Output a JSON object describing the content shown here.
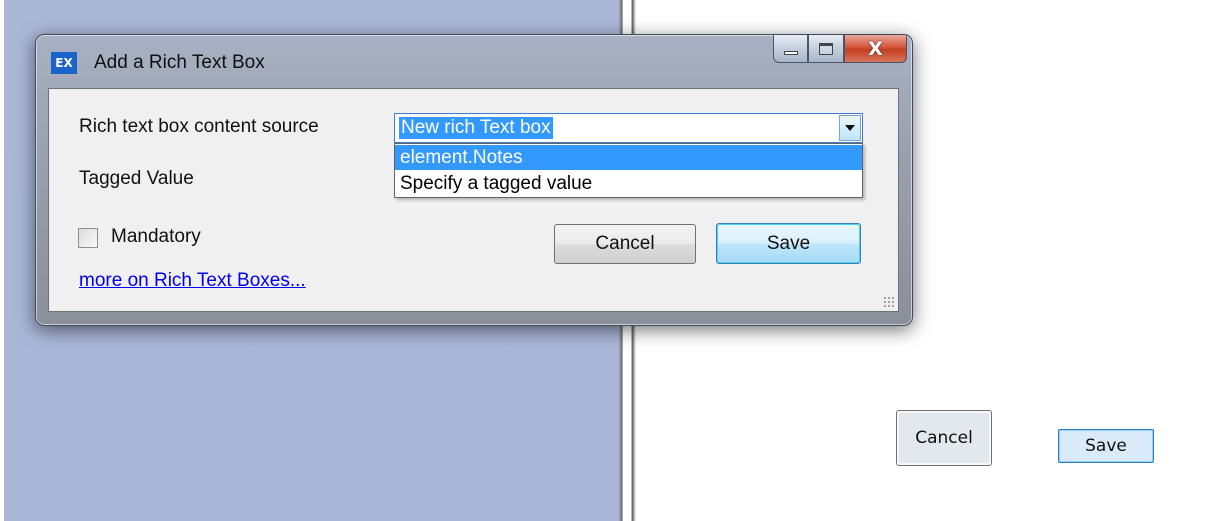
{
  "window": {
    "title": "Add a Rich Text Box",
    "app_icon_text": "EX",
    "close_glyph": "X"
  },
  "form": {
    "source_label": "Rich text box content source",
    "source_value": "New rich Text box",
    "source_options": [
      "element.Notes",
      "Specify a tagged value"
    ],
    "tagged_value_label": "Tagged Value",
    "mandatory_label": "Mandatory",
    "mandatory_checked": false,
    "help_link": "more on Rich Text Boxes...",
    "cancel_label": "Cancel",
    "save_label": "Save"
  },
  "background": {
    "cancel_label": "Cancel",
    "save_label": "Save"
  },
  "icons": {
    "app": "app-icon",
    "minimize": "minimize-icon",
    "maximize": "maximize-icon",
    "close": "close-icon",
    "dropdown": "chevron-down-icon",
    "grip": "resize-grip-icon"
  },
  "colors": {
    "selection": "#3399ff",
    "link": "#0000ee",
    "desktop_left": "#aab7d6"
  }
}
